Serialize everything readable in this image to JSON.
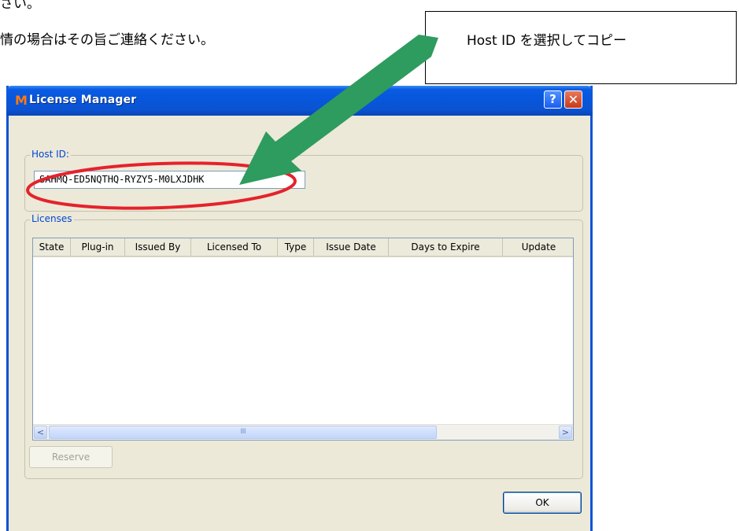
{
  "document": {
    "line1": "さい。",
    "line2": "情の場合はその旨ご連絡ください。"
  },
  "callout": {
    "text": "Host ID を選択してコピー"
  },
  "annotation": {
    "arrow_color": "#2e9b5f",
    "highlight_color": "#e5222b"
  },
  "dialog": {
    "title": "License Manager",
    "title_icon": "M",
    "help_button": "?",
    "close_button": "✕",
    "hostid_group_label": "Host ID:",
    "hostid_value": "SAHMQ-ED5NQTHQ-RYZY5-M0LXJDHK",
    "licenses_group_label": "Licenses",
    "columns": [
      "State",
      "Plug-in",
      "Issued By",
      "Licensed To",
      "Type",
      "Issue Date",
      "Days to Expire",
      "Update"
    ],
    "scroll_left": "<",
    "scroll_right": ">",
    "scroll_grip": "IIII",
    "reserve_label": "Reserve",
    "ok_label": "OK"
  }
}
